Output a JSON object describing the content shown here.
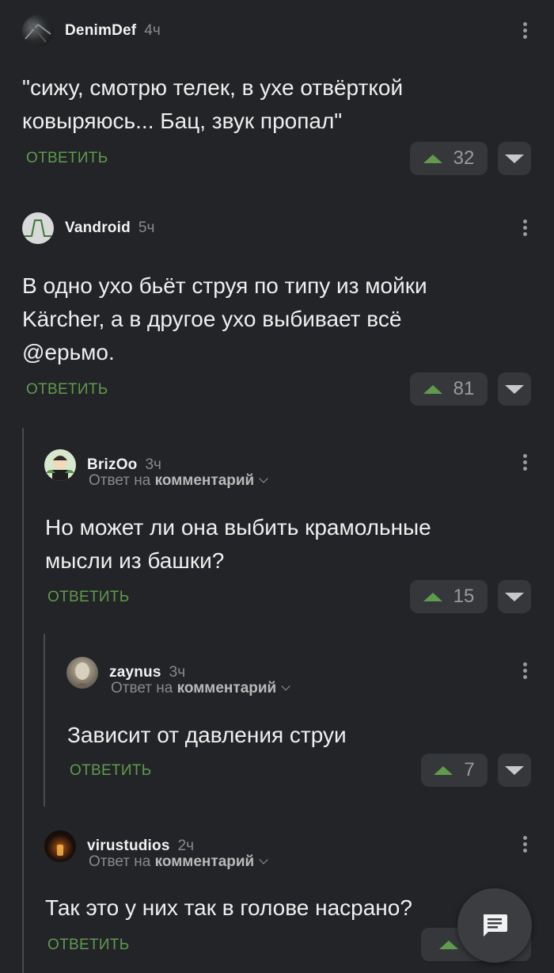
{
  "comments": [
    {
      "user": "DenimDef",
      "time": "4ч",
      "text_lines": [
        "\"сижу, смотрю телек, в ухе отвёрткой",
        "ковыряюсь... Бац, звук пропал\""
      ],
      "reply_label": "ОТВЕТИТЬ",
      "votes": "32"
    },
    {
      "user": "Vandroid",
      "time": "5ч",
      "text_lines": [
        "В одно ухо бьёт струя по типу из мойки",
        "Kärcher, а в другое ухо выбивает всё",
        "@ерьмо."
      ],
      "reply_label": "ОТВЕТИТЬ",
      "votes": "81"
    },
    {
      "user": "BrizOo",
      "time": "3ч",
      "reply_prefix": "Ответ на",
      "reply_target": "комментарий",
      "text_lines": [
        "Но может ли она выбить крамольные",
        "мысли из башки?"
      ],
      "reply_label": "ОТВЕТИТЬ",
      "votes": "15"
    },
    {
      "user": "zaynus",
      "time": "3ч",
      "reply_prefix": "Ответ на",
      "reply_target": "комментарий",
      "text_lines": [
        "Зависит от давления струи"
      ],
      "reply_label": "ОТВЕТИТЬ",
      "votes": "7"
    },
    {
      "user": "virustudios",
      "time": "2ч",
      "reply_prefix": "Ответ на",
      "reply_target": "комментарий",
      "text_lines": [
        "Так это у них так в голове насрано?"
      ],
      "reply_label": "ОТВЕТИТЬ",
      "votes": ""
    }
  ],
  "icons": {
    "upvote": "triangle-up-icon",
    "downvote": "triangle-down-icon",
    "menu": "more-vertical-icon",
    "fab": "comment-icon",
    "chevron": "chevron-down-icon"
  },
  "colors": {
    "background": "#232427",
    "accent_green": "#5f9a4d",
    "vote_bg": "#35373b"
  }
}
